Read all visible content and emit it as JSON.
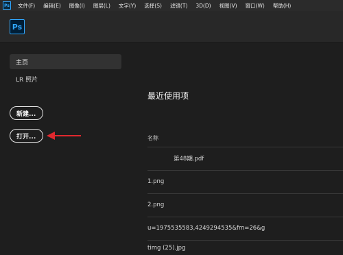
{
  "menubar": {
    "app_icon": "Ps",
    "items": [
      "文件(F)",
      "编辑(E)",
      "图像(I)",
      "图层(L)",
      "文字(Y)",
      "选择(S)",
      "滤镜(T)",
      "3D(D)",
      "视图(V)",
      "窗口(W)",
      "帮助(H)"
    ]
  },
  "toolbar": {
    "logo": "Ps"
  },
  "sidebar": {
    "home_label": "主页",
    "lr_label": "LR 照片",
    "new_button": "新建...",
    "open_button": "打开..."
  },
  "annotation": {
    "arrow_color": "#e0282e",
    "arrow_icon": "arrow-left-icon"
  },
  "main": {
    "title": "最近使用项",
    "column_name": "名称",
    "files": [
      "第48期.pdf",
      "1.png",
      "2.png",
      "u=1975535583,4249294535&fm=26&g",
      "timg (25).jpg"
    ]
  },
  "colors": {
    "accent": "#31a8ff",
    "background": "#1e1e1e",
    "menubar": "#2b2b2b"
  }
}
